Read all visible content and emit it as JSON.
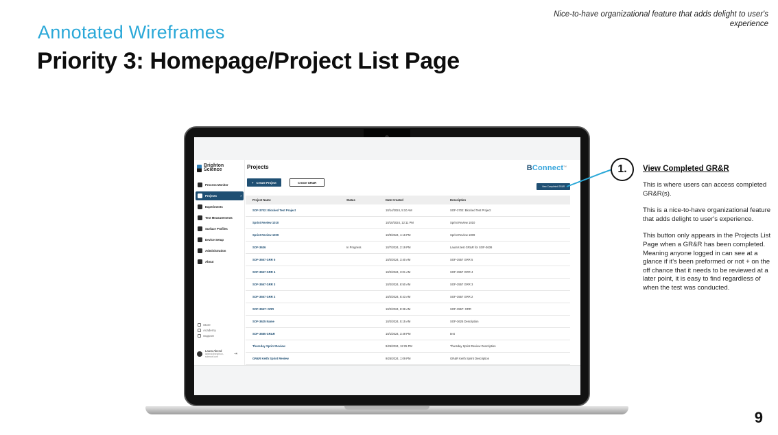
{
  "slide": {
    "top_note": "Nice-to-have organizational feature that adds delight to user's experience",
    "subtitle": "Annotated Wireframes",
    "title": "Priority 3: Homepage/Project List Page",
    "page_number": "9"
  },
  "app": {
    "logo_text": "Brighton Science",
    "brand_prefix": "B",
    "brand_suffix": "Connect",
    "brand_tm": "TM",
    "page_heading": "Projects",
    "create_project_label": "Create Project",
    "create_project_icon": "+",
    "create_grr_label": "Create GR&R",
    "view_completed_label": "View Completed GR&R",
    "sidebar": {
      "items": [
        {
          "label": "Process Monitor",
          "icon": "process-monitor-icon",
          "active": false
        },
        {
          "label": "Projects",
          "icon": "projects-icon",
          "active": true
        },
        {
          "label": "Experiments",
          "icon": "experiments-icon",
          "active": false
        },
        {
          "label": "Test Measurements",
          "icon": "test-measurements-icon",
          "active": false
        },
        {
          "label": "Surface Profiles",
          "icon": "surface-profiles-icon",
          "active": false
        },
        {
          "label": "Device Setup",
          "icon": "device-setup-icon",
          "active": false
        },
        {
          "label": "Administration",
          "icon": "administration-icon",
          "active": false
        },
        {
          "label": "About",
          "icon": "info-icon",
          "active": false
        }
      ],
      "links": [
        {
          "label": "Store"
        },
        {
          "label": "Academy"
        },
        {
          "label": "Support"
        }
      ],
      "user_name": "Laura Abend",
      "user_email": "labend@brighton-science.com"
    },
    "table": {
      "headers": [
        "Project Name",
        "Status",
        "Date Created",
        "Description"
      ],
      "rows": [
        [
          "SOF-3702: Blocked Test Project",
          "",
          "10/14/2024, 5:10 AM",
          "SOF-3702: Blocked Test Project"
        ],
        [
          "Sprint Review 1010",
          "",
          "10/10/2024, 12:11 PM",
          "Sprint Review 1010"
        ],
        [
          "Sprint Review 1009",
          "",
          "10/9/2024, 1:16 PM",
          "Sprint Review 1009"
        ],
        [
          "SOF-3636",
          "In Progress",
          "10/7/2024, 2:19 PM",
          "Laura's test GR&R for SOF-3636"
        ],
        [
          "SOF-3557 GRR 5",
          "",
          "10/2/2024, 3:40 AM",
          "SOF-3557 GRR 5"
        ],
        [
          "SOF-3557 GRR 4",
          "",
          "10/2/2024, 3:01 AM",
          "SOF-3557 GRR 4"
        ],
        [
          "SOF-3557 GRR 3",
          "",
          "10/2/2024, 8:50 AM",
          "SOF-3557 GRR 3"
        ],
        [
          "SOF-3557 GRR 2",
          "",
          "10/2/2024, 8:43 AM",
          "SOF-3557 GRR 2"
        ],
        [
          "SOF-3557: GRR",
          "",
          "10/2/2024, 8:38 AM",
          "SOF-3557: GRR"
        ],
        [
          "SOF-3625 Name",
          "",
          "10/2/2024, 5:15 AM",
          "SOF-3625 Description"
        ],
        [
          "SOF-3585 GR&R",
          "",
          "10/1/2024, 3:49 PM",
          "test"
        ],
        [
          "Thursday Sprint Review",
          "",
          "9/26/2024, 12:25 PM",
          "Thursday Sprint Review Description"
        ],
        [
          "GR&R Keith Sprint Review",
          "",
          "9/25/2024, 1:09 PM",
          "GR&R Keith Sprint Description"
        ]
      ]
    }
  },
  "callout": {
    "number": "1.",
    "title": "View Completed GR&R",
    "paragraphs": [
      "This is where users can access completed GR&R(s).",
      "This is a nice-to-have organizational feature that adds delight to user's experience.",
      "This button only appears in the Projects List Page when a GR&R has been completed. Meaning anyone logged in can see at a glance if it's been preformed or not + on the off chance that it needs to be reviewed at a later point, it is easy to find regardless of when the test was conducted."
    ],
    "line_color": "#2aa8d8"
  }
}
